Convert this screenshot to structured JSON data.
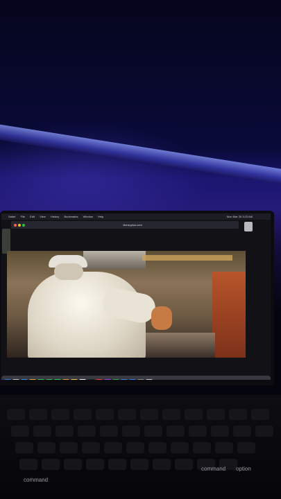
{
  "menubar": {
    "items": [
      "Safari",
      "File",
      "Edit",
      "View",
      "History",
      "Bookmarks",
      "Window",
      "Help"
    ],
    "clock": "Mon Mar 25  3:23 AM"
  },
  "browser": {
    "url": "disneyplus.com"
  },
  "keyboard": {
    "command_left": "command",
    "command_right": "command",
    "option_right": "option"
  },
  "dock": {
    "icons": [
      "finder-icon",
      "launchpad-icon",
      "safari-icon",
      "chrome-icon",
      "messages-icon",
      "facetime-icon",
      "whatsapp-icon",
      "photos-icon",
      "notes-icon",
      "reminders-icon",
      "appletv-icon",
      "music-icon",
      "podcasts-icon",
      "numbers-icon",
      "keynote-icon",
      "appstore-icon",
      "settings-icon",
      "trash-icon"
    ],
    "colors": [
      "#2f7be0",
      "#c9c9d0",
      "#2a9af0",
      "#e8b23a",
      "#34c759",
      "#34c759",
      "#25d366",
      "#f2a23b",
      "#f6d34a",
      "#ffffff",
      "#222222",
      "#fc3c44",
      "#9b4dde",
      "#30b34a",
      "#3a82f7",
      "#2a86f5",
      "#8e8e93",
      "#d0d0d6"
    ]
  }
}
